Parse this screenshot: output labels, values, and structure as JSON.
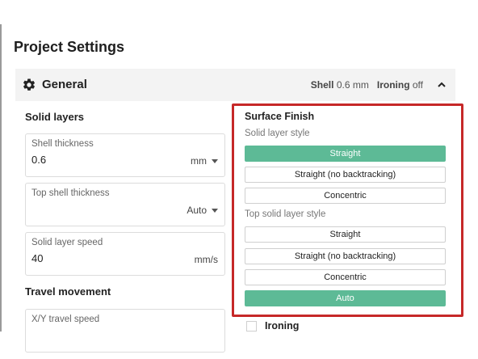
{
  "page": {
    "title": "Project Settings"
  },
  "section": {
    "title": "General",
    "summary": [
      {
        "key": "Shell",
        "value": "0.6 mm"
      },
      {
        "key": "Ironing",
        "value": "off"
      }
    ]
  },
  "solid_layers": {
    "label": "Solid layers",
    "fields": [
      {
        "label": "Shell thickness",
        "value": "0.6",
        "unit": "mm"
      },
      {
        "label": "Top shell thickness",
        "value": "",
        "unit": "Auto"
      },
      {
        "label": "Solid layer speed",
        "value": "40",
        "unit": "mm/s"
      }
    ]
  },
  "travel": {
    "label": "Travel movement",
    "fields": [
      {
        "label": "X/Y travel speed",
        "value": "",
        "unit": ""
      }
    ]
  },
  "surface_finish": {
    "title": "Surface Finish",
    "solid_style_label": "Solid layer style",
    "solid_options": [
      {
        "label": "Straight",
        "selected": true
      },
      {
        "label": "Straight (no backtracking)",
        "selected": false
      },
      {
        "label": "Concentric",
        "selected": false
      }
    ],
    "top_style_label": "Top solid layer style",
    "top_options": [
      {
        "label": "Straight",
        "selected": false
      },
      {
        "label": "Straight (no backtracking)",
        "selected": false
      },
      {
        "label": "Concentric",
        "selected": false
      },
      {
        "label": "Auto",
        "selected": true
      }
    ]
  },
  "ironing": {
    "label": "Ironing",
    "checked": false
  },
  "colors": {
    "accent": "#5dba96",
    "highlight_border": "#c62828"
  }
}
